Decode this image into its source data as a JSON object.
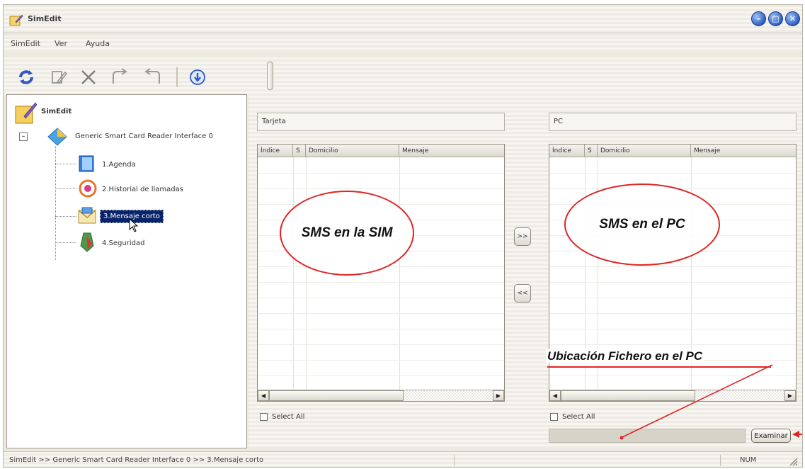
{
  "window": {
    "title": "SimEdit",
    "controls": {
      "minimize": "–",
      "maximize": "□",
      "close": "✕"
    }
  },
  "menu": [
    "SimEdit",
    "Ver",
    "Ayuda"
  ],
  "tree": {
    "root": "SimEdit",
    "device": "Generic Smart Card Reader Interface 0",
    "items": [
      "1.Agenda",
      "2.Historial de llamadas",
      "3.Mensaje corto",
      "4.Seguridad"
    ],
    "expand_symbol": "–"
  },
  "left_panel": {
    "label": "Tarjeta",
    "columns": [
      "Índice",
      "S",
      "Domicilio",
      "Mensaje"
    ],
    "select_all": "Select All"
  },
  "right_panel": {
    "label": "PC",
    "columns": [
      "Índice",
      "S",
      "Domicilio",
      "Mensaje"
    ],
    "select_all": "Select All"
  },
  "transfer": {
    "to_pc": ">>",
    "to_sim": "<<"
  },
  "browse_button": "Examinar",
  "annotations": {
    "sim": "SMS en la SIM",
    "pc": "SMS en el PC",
    "location": "Ubicación Fichero en el PC"
  },
  "statusbar": {
    "path": "SimEdit  >>  Generic Smart Card Reader Interface 0  >>  3.Mensaje corto",
    "num": "NUM"
  },
  "colors": {
    "annotation": "#e02525",
    "selection": "#0a246a"
  }
}
